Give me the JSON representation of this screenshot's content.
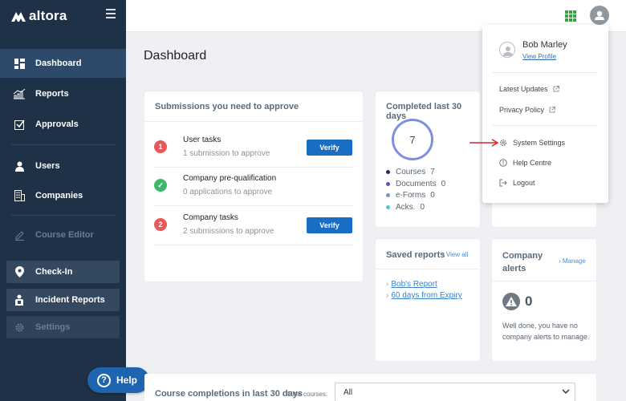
{
  "brand": {
    "name": "altora"
  },
  "sidebar": {
    "items": [
      {
        "label": "Dashboard",
        "icon": "dashboard-icon"
      },
      {
        "label": "Reports",
        "icon": "reports-icon"
      },
      {
        "label": "Approvals",
        "icon": "approvals-icon"
      },
      {
        "label": "Users",
        "icon": "users-icon"
      },
      {
        "label": "Companies",
        "icon": "companies-icon"
      },
      {
        "label": "Course Editor",
        "icon": "course-editor-icon"
      },
      {
        "label": "Check-In",
        "icon": "location-pin-icon"
      },
      {
        "label": "Incident Reports",
        "icon": "incident-reports-icon"
      },
      {
        "label": "Settings",
        "icon": "gear-icon"
      }
    ],
    "help_label": "Help"
  },
  "page": {
    "title": "Dashboard"
  },
  "submissions": {
    "title": "Submissions you need to approve",
    "rows": [
      {
        "badge": "1",
        "title": "User tasks",
        "subtitle": "1 submission to approve",
        "button": "Verify"
      },
      {
        "badge": "✓",
        "title": "Company pre-qualification",
        "subtitle": "0 applications to approve"
      },
      {
        "badge": "2",
        "title": "Company tasks",
        "subtitle": "2 submissions to approve",
        "button": "Verify"
      }
    ]
  },
  "completed": {
    "title": "Completed last 30 days",
    "total": "7",
    "legend": [
      {
        "label": "Courses",
        "value": "7",
        "color": "#1f2f4f"
      },
      {
        "label": "Documents",
        "value": "0",
        "color": "#5a4fc4"
      },
      {
        "label": "e-Forms",
        "value": "0",
        "color": "#7d8fe0"
      },
      {
        "label": "Acks.",
        "value": "0",
        "color": "#4cc3e0"
      }
    ]
  },
  "saved_reports": {
    "title": "Saved reports",
    "view_all": "View all",
    "items": [
      "Bob's Report",
      "60 days from Expiry"
    ]
  },
  "company_alerts": {
    "title": "Company alerts",
    "manage": "Manage",
    "count": "0",
    "message": "Well done, you have no company alerts to manage."
  },
  "course_completions": {
    "title": "Course completions in last 30 days",
    "filter_label": "Filter courses:",
    "filter_value": "All"
  },
  "user_menu": {
    "name": "Bob Marley",
    "view_profile": "View Profile",
    "items": [
      {
        "label": "Latest Updates",
        "external": true
      },
      {
        "label": "Privacy Policy",
        "external": true
      },
      {
        "label": "System Settings",
        "icon": "gear-icon"
      },
      {
        "label": "Help Centre",
        "icon": "info-icon"
      },
      {
        "label": "Logout",
        "icon": "logout-icon"
      }
    ]
  },
  "colors": {
    "sidebar": "#1f3147",
    "sidebar_active": "#2d4a6a",
    "primary": "#1a6dc4",
    "apps": "#37a33d",
    "arrow": "#d0262b"
  }
}
